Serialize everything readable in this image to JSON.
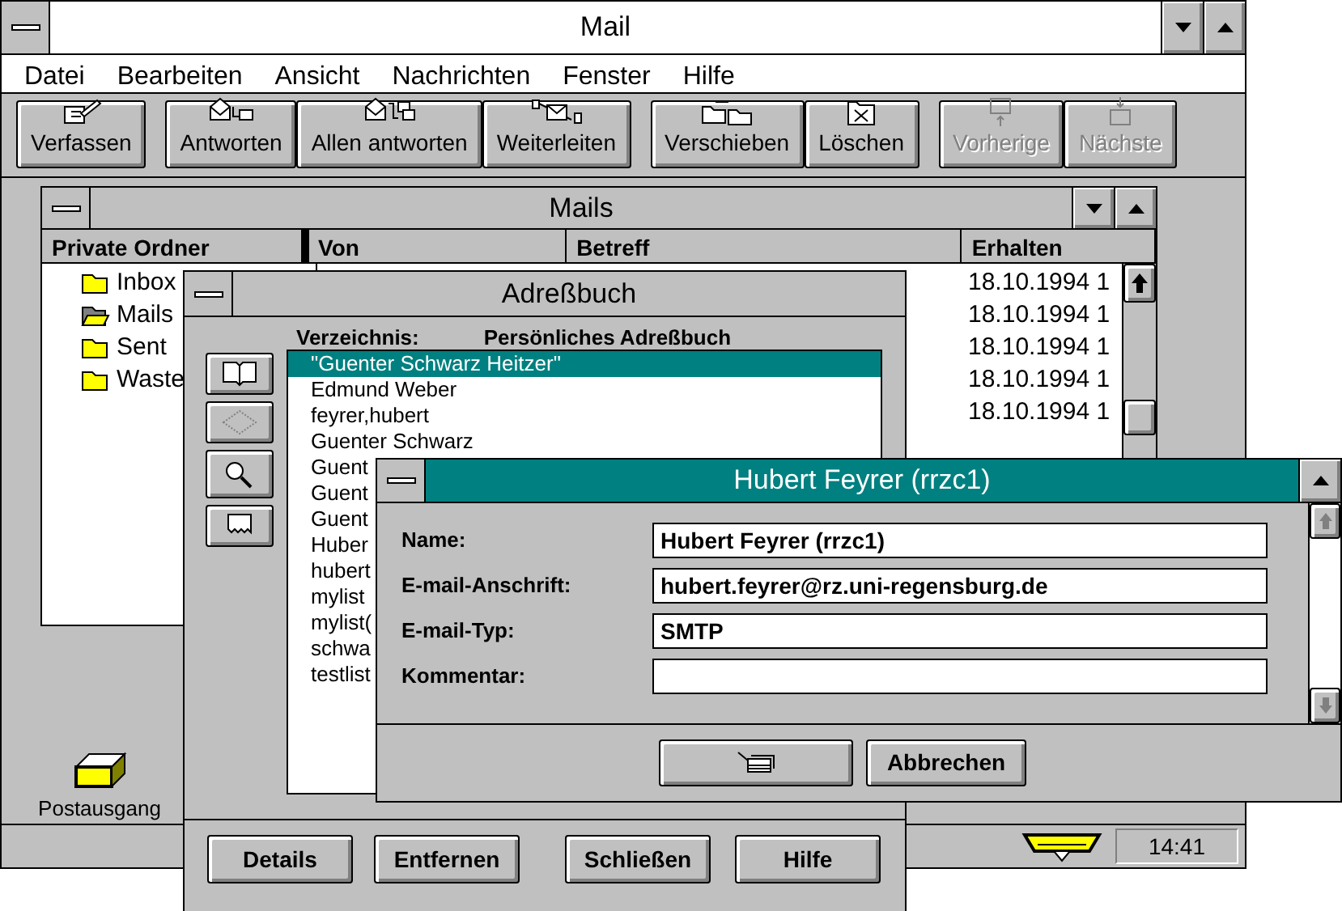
{
  "main_window": {
    "title": "Mail",
    "menu": [
      "Datei",
      "Bearbeiten",
      "Ansicht",
      "Nachrichten",
      "Fenster",
      "Hilfe"
    ],
    "toolbar": [
      [
        {
          "label": "Verfassen",
          "disabled": false
        }
      ],
      [
        {
          "label": "Antworten",
          "disabled": false
        },
        {
          "label": "Allen antworten",
          "disabled": false
        },
        {
          "label": "Weiterleiten",
          "disabled": false
        }
      ],
      [
        {
          "label": "Verschieben",
          "disabled": false
        },
        {
          "label": "Löschen",
          "disabled": false
        }
      ],
      [
        {
          "label": "Vorherige",
          "disabled": true
        },
        {
          "label": "Nächste",
          "disabled": true
        }
      ]
    ],
    "status_bar": {
      "time": "14:41"
    }
  },
  "mails_window": {
    "title": "Mails",
    "columns": [
      "Private Ordner",
      "Von",
      "Betreff",
      "Erhalten"
    ],
    "folders": [
      {
        "name": "Inbox",
        "open": false
      },
      {
        "name": "Mails",
        "open": true
      },
      {
        "name": "Sent",
        "open": false
      },
      {
        "name": "Waste",
        "open": false
      }
    ],
    "received": [
      "18.10.1994 1",
      "18.10.1994 1",
      "18.10.1994 1",
      "18.10.1994 1",
      "18.10.1994 1"
    ]
  },
  "minimized_icons": [
    {
      "label": "Postausgang"
    }
  ],
  "address_book": {
    "title": "Adreßbuch",
    "directory_label": "Verzeichnis:",
    "directory": "Persönliches Adreßbuch",
    "entries": [
      {
        "name": "\"Guenter Schwarz Heitzer\"",
        "selected": true
      },
      {
        "name": "Edmund Weber",
        "selected": false
      },
      {
        "name": "feyrer,hubert",
        "selected": false
      },
      {
        "name": "Guenter Schwarz",
        "selected": false
      },
      {
        "name": "Guent",
        "selected": false
      },
      {
        "name": "Guent",
        "selected": false
      },
      {
        "name": "Guent",
        "selected": false
      },
      {
        "name": "Huber",
        "selected": false
      },
      {
        "name": "hubert",
        "selected": false
      },
      {
        "name": "mylist",
        "selected": false
      },
      {
        "name": "mylist(",
        "selected": false
      },
      {
        "name": "schwa",
        "selected": false
      },
      {
        "name": "testlist",
        "selected": false
      }
    ],
    "buttons": [
      "Details",
      "Entfernen",
      "Schließen",
      "Hilfe"
    ]
  },
  "details_dialog": {
    "title": "Hubert Feyrer (rrzc1)",
    "fields": [
      {
        "label": "Name:",
        "value": "Hubert Feyrer (rrzc1)"
      },
      {
        "label": "E-mail-Anschrift:",
        "value": "hubert.feyrer@rz.uni-regensburg.de"
      },
      {
        "label": "E-mail-Typ:",
        "value": "SMTP"
      },
      {
        "label": "Kommentar:"
      }
    ],
    "buttons": [
      {
        "kind": "icon"
      },
      {
        "kind": "text",
        "label": "Abbrechen"
      }
    ]
  }
}
